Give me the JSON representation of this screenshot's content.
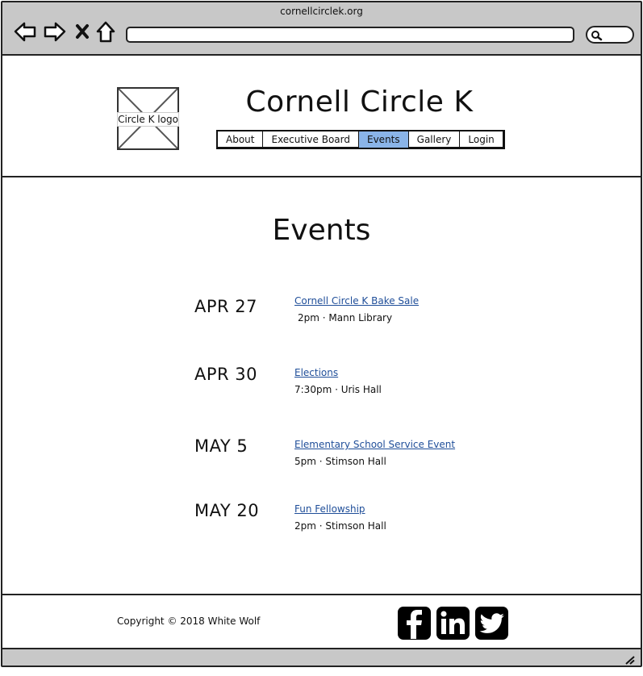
{
  "browser": {
    "url": "cornellcirclek.org",
    "icons": [
      "back-icon",
      "forward-icon",
      "close-icon",
      "home-icon",
      "search-icon"
    ]
  },
  "header": {
    "logo_label": "Circle K logo",
    "title": "Cornell Circle K",
    "nav": [
      "About",
      "Executive Board",
      "Events",
      "Gallery",
      "Login"
    ],
    "active_nav": "Events",
    "accent_color": "#8ab4e8"
  },
  "main": {
    "heading": "Events",
    "events": [
      {
        "date": "APR 27",
        "title": "Cornell Circle K Bake Sale",
        "meta": "2pm · Mann Library"
      },
      {
        "date": "APR 30",
        "title": "Elections",
        "meta": "7:30pm · Uris Hall"
      },
      {
        "date": "MAY 5",
        "title": "Elementary School Service Event",
        "meta": "5pm · Stimson Hall"
      },
      {
        "date": "MAY 20",
        "title": "Fun Fellowship",
        "meta": "2pm · Stimson Hall"
      }
    ],
    "link_color": "#1f4e99"
  },
  "footer": {
    "copyright": "Copyright © 2018 White Wolf",
    "social": [
      "facebook-icon",
      "linkedin-icon",
      "twitter-icon"
    ]
  }
}
